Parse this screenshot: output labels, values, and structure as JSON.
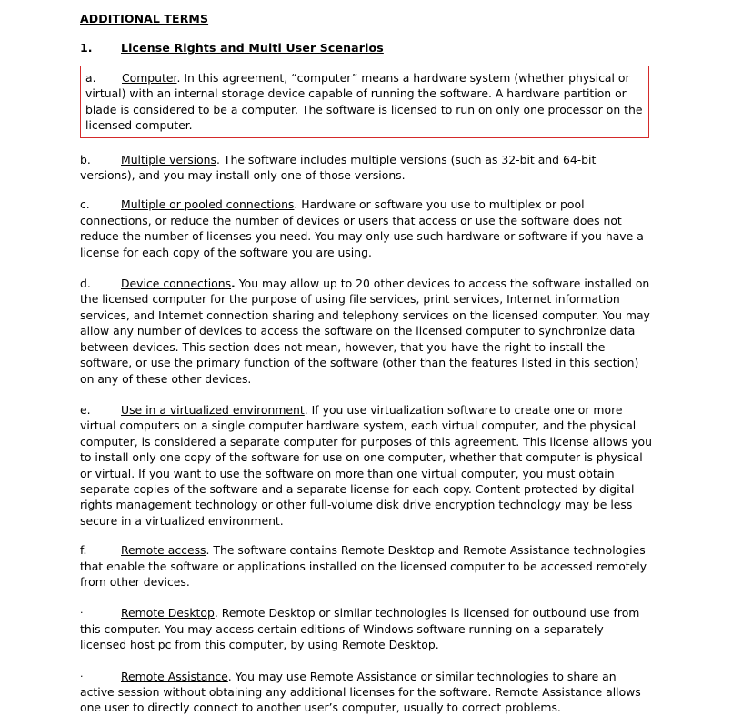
{
  "document": {
    "title": "ADDITIONAL TERMS",
    "section": {
      "number": "1.",
      "heading": "License Rights and Multi User Scenarios"
    },
    "clauses": [
      {
        "marker": "a.",
        "term": "Computer",
        "term_punct": ".",
        "body": " In this agreement, “computer” means a hardware system (whether physical or virtual) with an internal storage device capable of running the software. A hardware partition or blade is considered to be a computer. The software is licensed to run on only one processor on the licensed computer.",
        "boxed": true,
        "box_color": "#d42a2a"
      },
      {
        "marker": "b.",
        "term": "Multiple versions",
        "term_punct": ".",
        "body": " The software includes multiple versions (such as 32-bit and 64-bit versions), and you may install only one of those versions.",
        "boxed": false
      },
      {
        "marker": "c.",
        "term": "Multiple or pooled connections",
        "term_punct": ".",
        "body": " Hardware or software you use to multiplex or pool connections, or reduce the number of devices or users that access or use the software does not reduce the number of licenses you need. You may only use such hardware or software if you have a license for each copy of the software you are using.",
        "boxed": false
      },
      {
        "marker": "d.",
        "term": "Device connections",
        "term_punct": ".",
        "body": " You may allow up to 20 other devices to access the software installed on the licensed computer for the purpose of using file services, print services, Internet information services, and Internet connection sharing and telephony services on the licensed computer. You may allow any number of devices to access the software on the licensed computer to synchronize data between devices. This section does not mean, however, that you have the right to install the software, or use the primary function of the software (other than the features listed in this section) on any of these other devices.",
        "boxed": false
      },
      {
        "marker": "e.",
        "term": "Use in a virtualized environment",
        "term_punct": ".",
        "body": " If you use virtualization software to create one or more virtual computers on a single computer hardware system, each virtual computer, and the physical computer, is considered a separate computer for purposes of this agreement. This license allows you to install only one copy of the software for use on one computer, whether that computer is physical or virtual. If you want to use the software on more than one virtual computer, you must obtain separate copies of the software and a separate license for each copy. Content protected by digital rights management technology or other full-volume disk drive encryption technology may be less secure in a virtualized environment.",
        "boxed": false
      },
      {
        "marker": "f.",
        "term": "Remote access",
        "term_punct": ".",
        "body": " The software contains Remote Desktop and Remote Assistance technologies that enable the software or applications installed on the licensed computer to be accessed remotely from other devices.",
        "boxed": false
      },
      {
        "marker": "·",
        "term": "Remote Desktop",
        "term_punct": ".",
        "body": " Remote Desktop or similar technologies is licensed for outbound use from this computer. You may access certain editions of Windows software running on a separately licensed host pc from this computer, by using Remote Desktop.",
        "boxed": false
      },
      {
        "marker": "·",
        "term": "Remote Assistance",
        "term_punct": ".",
        "body": " You may use Remote Assistance or similar technologies to share an active session without obtaining any additional licenses for the software. Remote Assistance allows one user to directly connect to another user’s computer, usually to correct problems.",
        "boxed": false
      }
    ]
  }
}
